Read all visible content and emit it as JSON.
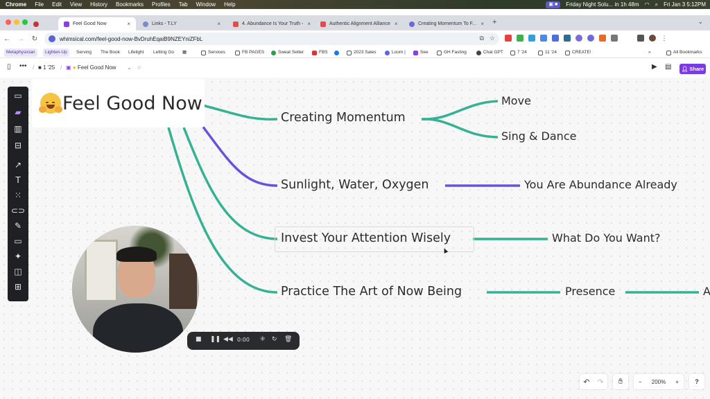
{
  "menubar": {
    "items": [
      "Chrome",
      "File",
      "Edit",
      "View",
      "History",
      "Bookmarks",
      "Profiles",
      "Tab",
      "Window",
      "Help"
    ],
    "event": "Friday Night Solu... in 1h 48m",
    "datetime": "Fri Jan 3  5:12PM"
  },
  "tabs": [
    {
      "title": "Feel Good Now",
      "active": true
    },
    {
      "title": "Links - T.LY",
      "active": false
    },
    {
      "title": "4. Abundance Is Your Truth -",
      "active": false
    },
    {
      "title": "Authentic Alignment Alliance",
      "active": false
    },
    {
      "title": "Creating Momentum To F...",
      "active": false
    }
  ],
  "address": {
    "url": "whimsical.com/feel-good-now-BvDruhEqaiB9NZEYniZFbL"
  },
  "bookmarks": [
    "Metaphysician",
    "Lighten-Up",
    "Serving",
    "The Book",
    "Lifelight",
    "Letting Go",
    "Services",
    "FB PAGES",
    "Sweat Setter",
    "FBS",
    "2023 Sales",
    "Loom |",
    "See",
    "GH Fasting",
    "Chat GPT",
    "7 '24",
    "11 '24",
    "CREATE!",
    "All Bookmarks"
  ],
  "header": {
    "folder": "1 '25",
    "doc_title": "Feel Good Now",
    "share_label": "Share"
  },
  "mindmap": {
    "root": "Feel Good Now",
    "branch_creating": "Creating Momentum",
    "leaf_move": "Move",
    "leaf_sing": "Sing & Dance",
    "branch_sunlight": "Sunlight, Water, Oxygen",
    "leaf_abundance": "You  Are Abundance Already",
    "branch_invest": "Invest Your Attention Wisely",
    "leaf_want": "What Do You Want?",
    "branch_practice": "Practice The Art of Now Being",
    "leaf_presence": "Presence",
    "leaf_cut": "A",
    "colors": {
      "teal": "#35b293",
      "purple": "#6a50dc"
    }
  },
  "recorder": {
    "time": "0:00"
  },
  "zoom": {
    "level": "200%",
    "minus": "−",
    "plus": "+"
  },
  "help": "?"
}
